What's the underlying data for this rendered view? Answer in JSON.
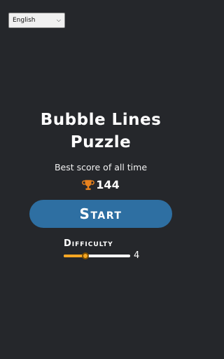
{
  "language_select": {
    "value": "English",
    "icon": "chevron-down-icon"
  },
  "title": {
    "line1": "Bubble Lines",
    "line2": "Puzzle"
  },
  "best_score": {
    "label": "Best score of all time",
    "value": "144",
    "icon": "trophy-icon"
  },
  "start_button": {
    "label": "Start"
  },
  "difficulty": {
    "label": "Difficulty",
    "value": "4",
    "level_fraction": 0.33
  },
  "colors": {
    "background": "#25272b",
    "button": "#2e6fa2",
    "accent": "#f5a623"
  }
}
